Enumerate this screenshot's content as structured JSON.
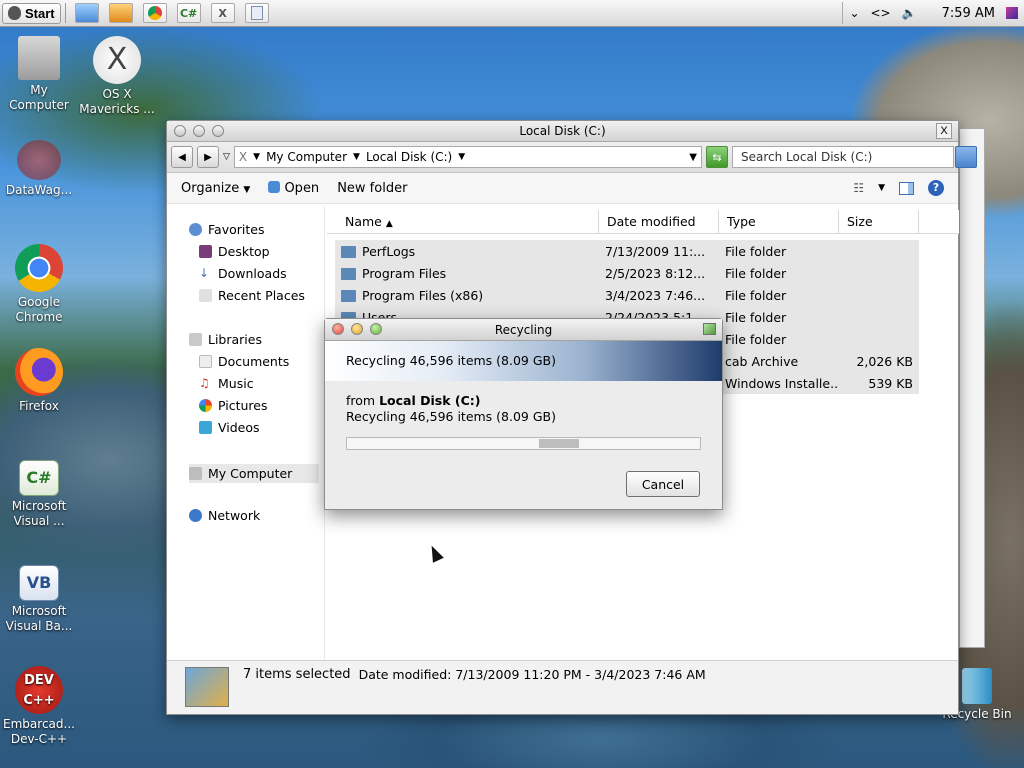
{
  "taskbar": {
    "start_label": "Start",
    "clock": "7:59 AM",
    "tray_icons": [
      "chevron-down-icon",
      "code-icon",
      "speaker-icon",
      "color-swatch-icon"
    ]
  },
  "desktop": {
    "icons": [
      {
        "label": "My Computer",
        "icon": "computer-icon"
      },
      {
        "label": "OS X Mavericks ...",
        "icon": "osx-icon"
      },
      {
        "label": "DataWag...",
        "icon": "datawag-icon"
      },
      {
        "label": "Google Chrome",
        "icon": "chrome-icon"
      },
      {
        "label": "Firefox",
        "icon": "firefox-icon"
      },
      {
        "label": "Microsoft Visual ...",
        "icon": "visual-csharp-icon"
      },
      {
        "label": "Microsoft Visual Ba...",
        "icon": "visual-basic-icon"
      },
      {
        "label": "Embarcad... Dev-C++",
        "icon": "devcpp-icon"
      },
      {
        "label": "Recycle Bin",
        "icon": "recycle-bin-icon"
      }
    ]
  },
  "explorer": {
    "title": "Local Disk (C:)",
    "close": "X",
    "breadcrumb": [
      "X",
      "My Computer",
      "Local Disk (C:)"
    ],
    "search_placeholder": "Search Local Disk (C:)",
    "toolbar": {
      "organize": "Organize",
      "open": "Open",
      "new_folder": "New folder"
    },
    "nav": {
      "favorites": "Favorites",
      "desktop": "Desktop",
      "downloads": "Downloads",
      "recent": "Recent Places",
      "libraries": "Libraries",
      "documents": "Documents",
      "music": "Music",
      "pictures": "Pictures",
      "videos": "Videos",
      "computer": "My Computer",
      "network": "Network"
    },
    "columns": {
      "name": "Name",
      "date": "Date modified",
      "type": "Type",
      "size": "Size"
    },
    "rows": [
      {
        "name": "PerfLogs",
        "date": "7/13/2009 11:...",
        "type": "File folder",
        "size": ""
      },
      {
        "name": "Program Files",
        "date": "2/5/2023 8:12...",
        "type": "File folder",
        "size": ""
      },
      {
        "name": "Program Files (x86)",
        "date": "3/4/2023 7:46...",
        "type": "File folder",
        "size": ""
      },
      {
        "name": "Users",
        "date": "2/24/2023 5:1...",
        "type": "File folder",
        "size": ""
      },
      {
        "name": "",
        "date": "",
        "type": "File folder",
        "size": ""
      },
      {
        "name": "",
        "date": "",
        "type": "cab Archive",
        "size": "2,026 KB"
      },
      {
        "name": "",
        "date": "",
        "type": "Windows Installe...",
        "size": "539 KB"
      }
    ],
    "status": {
      "selected": "7 items selected",
      "date_label": "Date modified: 7/13/2009 11:20 PM - 3/4/2023 7:46 AM"
    }
  },
  "dialog": {
    "title": "Recycling",
    "banner": "Recycling 46,596 items (8.09 GB)",
    "from_prefix": "from ",
    "from_location": "Local Disk (C:)",
    "detail": "Recycling 46,596 items (8.09 GB)",
    "cancel": "Cancel"
  },
  "colors": {
    "accent": "#2d62b8",
    "folder": "#5b88b6",
    "dialog_banner_dark": "#1e3c6b"
  }
}
